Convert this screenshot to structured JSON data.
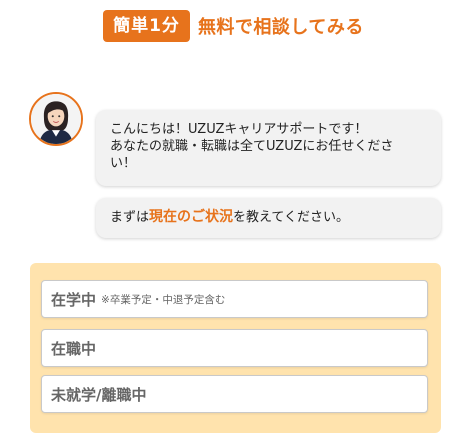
{
  "header": {
    "badge": "簡単1分",
    "title": "無料で相談してみる"
  },
  "colors": {
    "accent": "#e7731c",
    "panel": "#ffe3ad",
    "bubble": "#f2f2f2"
  },
  "chat": {
    "avatar_icon": "advisor-avatar",
    "message_1": {
      "line_1": "こんにちは！UZUZキャリアサポートです！",
      "line_2": "あなたの就職・転職は全てUZUZにお任せくださ",
      "line_3": "い！"
    },
    "message_2": {
      "prefix": "まずは",
      "highlight": "現在のご状況",
      "suffix": "を教えてください。"
    }
  },
  "options": [
    {
      "label": "在学中",
      "note": "※卒業予定・中退予定含む"
    },
    {
      "label": "在職中",
      "note": ""
    },
    {
      "label": "未就学/離職中",
      "note": ""
    }
  ]
}
